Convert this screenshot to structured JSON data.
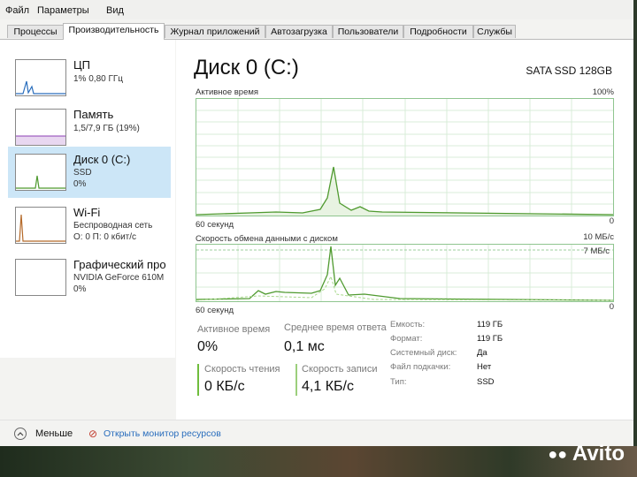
{
  "menu": [
    "Файл",
    "Параметры",
    "Вид"
  ],
  "tabs": [
    "Процессы",
    "Производительность",
    "Журнал приложений",
    "Автозагрузка",
    "Пользователи",
    "Подробности",
    "Службы"
  ],
  "sidebar": {
    "items": [
      {
        "title": "ЦП",
        "line1": "1% 0,80 ГГц",
        "line2": ""
      },
      {
        "title": "Память",
        "line1": "1,5/7,9 ГБ (19%)",
        "line2": ""
      },
      {
        "title": "Диск 0 (C:)",
        "line1": "SSD",
        "line2": "0%"
      },
      {
        "title": "Wi-Fi",
        "line1": "Беспроводная сеть",
        "line2": "О: 0 П: 0 кбит/с"
      },
      {
        "title": "Графический про",
        "line1": "NVIDIA GeForce 610M",
        "line2": "0%"
      }
    ]
  },
  "main": {
    "title": "Диск 0 (C:)",
    "model": "SATA SSD 128GB",
    "graph1": {
      "label": "Активное время",
      "max": "100%",
      "time_label": "60 секунд",
      "min": "0"
    },
    "graph2": {
      "label": "Скорость обмена данными с диском",
      "max": "10 МБ/с",
      "inner": "7 МБ/с",
      "time_label": "60 секунд",
      "min": "0"
    },
    "stats": {
      "active_time_label": "Активное время",
      "active_time_value": "0%",
      "response_label": "Среднее время ответа",
      "response_value": "0,1 мс",
      "read_label": "Скорость чтения",
      "read_value": "0 КБ/с",
      "write_label": "Скорость записи",
      "write_value": "4,1 КБ/с"
    },
    "properties": [
      {
        "label": "Емкость:",
        "value": "119 ГБ"
      },
      {
        "label": "Формат:",
        "value": "119 ГБ"
      },
      {
        "label": "Системный диск:",
        "value": "Да"
      },
      {
        "label": "Файл подкачки:",
        "value": "Нет"
      },
      {
        "label": "Тип:",
        "value": "SSD"
      }
    ]
  },
  "footer": {
    "less": "Меньше",
    "resource_monitor": "Открыть монитор ресурсов"
  },
  "watermark": "Avito",
  "colors": {
    "accent_green": "#6fbd3c",
    "selected_bg": "#cce6f7",
    "link": "#2a6ebd"
  }
}
